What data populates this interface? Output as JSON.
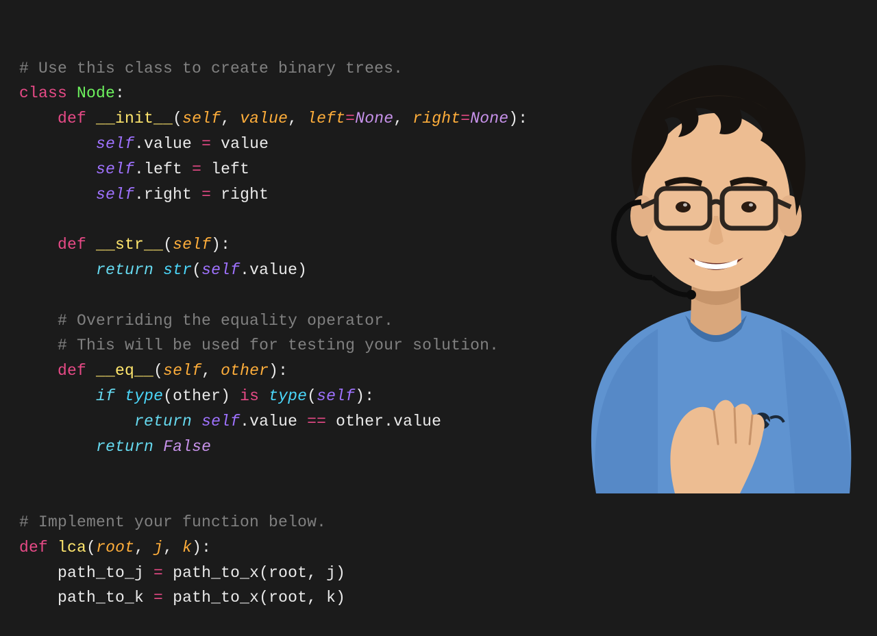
{
  "colors": {
    "background": "#1b1b1b",
    "comment": "#808080",
    "keyword_flow": "#66d9ef",
    "keyword_def": "#e64a86",
    "classname": "#6df25e",
    "funcname": "#ffe66d",
    "param": "#ffae3b",
    "const": "#c792ea",
    "builtin": "#4bd6f9",
    "self": "#9f72ff",
    "operator": "#e64a86",
    "plain": "#eaeaea"
  },
  "code_lines": [
    [
      [
        "comment",
        "# Use this class to create binary trees."
      ]
    ],
    [
      [
        "keyword2",
        "class"
      ],
      [
        "plain",
        " "
      ],
      [
        "classname",
        "Node"
      ],
      [
        "plain",
        ":"
      ]
    ],
    [
      [
        "plain",
        "    "
      ],
      [
        "keyword2",
        "def"
      ],
      [
        "plain",
        " "
      ],
      [
        "dunder",
        "__init__"
      ],
      [
        "plain",
        "("
      ],
      [
        "param",
        "self"
      ],
      [
        "plain",
        ", "
      ],
      [
        "param",
        "value"
      ],
      [
        "plain",
        ", "
      ],
      [
        "param",
        "left"
      ],
      [
        "op",
        "="
      ],
      [
        "const",
        "None"
      ],
      [
        "plain",
        ", "
      ],
      [
        "param",
        "right"
      ],
      [
        "op",
        "="
      ],
      [
        "const",
        "None"
      ],
      [
        "plain",
        "):"
      ]
    ],
    [
      [
        "plain",
        "        "
      ],
      [
        "self",
        "self"
      ],
      [
        "plain",
        ".value "
      ],
      [
        "op",
        "="
      ],
      [
        "plain",
        " value"
      ]
    ],
    [
      [
        "plain",
        "        "
      ],
      [
        "self",
        "self"
      ],
      [
        "plain",
        ".left "
      ],
      [
        "op",
        "="
      ],
      [
        "plain",
        " left"
      ]
    ],
    [
      [
        "plain",
        "        "
      ],
      [
        "self",
        "self"
      ],
      [
        "plain",
        ".right "
      ],
      [
        "op",
        "="
      ],
      [
        "plain",
        " right"
      ]
    ],
    [
      [
        "plain",
        " "
      ]
    ],
    [
      [
        "plain",
        "    "
      ],
      [
        "keyword2",
        "def"
      ],
      [
        "plain",
        " "
      ],
      [
        "dunder",
        "__str__"
      ],
      [
        "plain",
        "("
      ],
      [
        "param",
        "self"
      ],
      [
        "plain",
        "):"
      ]
    ],
    [
      [
        "plain",
        "        "
      ],
      [
        "keyword",
        "return"
      ],
      [
        "plain",
        " "
      ],
      [
        "builtin",
        "str"
      ],
      [
        "plain",
        "("
      ],
      [
        "self",
        "self"
      ],
      [
        "plain",
        ".value)"
      ]
    ],
    [
      [
        "plain",
        " "
      ]
    ],
    [
      [
        "plain",
        "    "
      ],
      [
        "comment",
        "# Overriding the equality operator."
      ]
    ],
    [
      [
        "plain",
        "    "
      ],
      [
        "comment",
        "# This will be used for testing your solution."
      ]
    ],
    [
      [
        "plain",
        "    "
      ],
      [
        "keyword2",
        "def"
      ],
      [
        "plain",
        " "
      ],
      [
        "dunder",
        "__eq__"
      ],
      [
        "plain",
        "("
      ],
      [
        "param",
        "self"
      ],
      [
        "plain",
        ", "
      ],
      [
        "param",
        "other"
      ],
      [
        "plain",
        "):"
      ]
    ],
    [
      [
        "plain",
        "        "
      ],
      [
        "keyword",
        "if"
      ],
      [
        "plain",
        " "
      ],
      [
        "builtin",
        "type"
      ],
      [
        "plain",
        "(other) "
      ],
      [
        "op",
        "is"
      ],
      [
        "plain",
        " "
      ],
      [
        "builtin",
        "type"
      ],
      [
        "plain",
        "("
      ],
      [
        "self",
        "self"
      ],
      [
        "plain",
        "):"
      ]
    ],
    [
      [
        "plain",
        "            "
      ],
      [
        "keyword",
        "return"
      ],
      [
        "plain",
        " "
      ],
      [
        "self",
        "self"
      ],
      [
        "plain",
        ".value "
      ],
      [
        "op",
        "=="
      ],
      [
        "plain",
        " other.value"
      ]
    ],
    [
      [
        "plain",
        "        "
      ],
      [
        "keyword",
        "return"
      ],
      [
        "plain",
        " "
      ],
      [
        "const",
        "False"
      ]
    ],
    [
      [
        "plain",
        " "
      ]
    ],
    [
      [
        "plain",
        " "
      ]
    ],
    [
      [
        "comment",
        "# Implement your function below."
      ]
    ],
    [
      [
        "keyword2",
        "def"
      ],
      [
        "plain",
        " "
      ],
      [
        "funcname",
        "lca"
      ],
      [
        "plain",
        "("
      ],
      [
        "param",
        "root"
      ],
      [
        "plain",
        ", "
      ],
      [
        "param",
        "j"
      ],
      [
        "plain",
        ", "
      ],
      [
        "param",
        "k"
      ],
      [
        "plain",
        "):"
      ]
    ],
    [
      [
        "plain",
        "    path_to_j "
      ],
      [
        "op",
        "="
      ],
      [
        "plain",
        " path_to_x(root, j)"
      ]
    ],
    [
      [
        "plain",
        "    path_to_k "
      ],
      [
        "op",
        "="
      ],
      [
        "plain",
        " path_to_x(root, k)"
      ]
    ]
  ],
  "presenter": {
    "description": "young man with dark hair and glasses, light-blue t-shirt, headset mic, gesturing",
    "shirt_color": "#5f93d0",
    "shirt_logo": "{ ninja }"
  }
}
